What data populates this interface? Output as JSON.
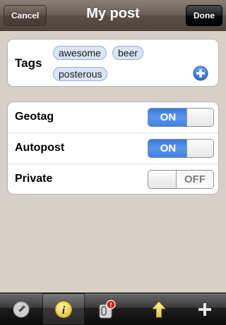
{
  "navbar": {
    "title": "My post",
    "cancel_label": "Cancel",
    "done_label": "Done"
  },
  "tags": {
    "label": "Tags",
    "items": [
      "awesome",
      "beer",
      "posterous"
    ],
    "add_icon": "plus-circle-icon"
  },
  "settings": [
    {
      "label": "Geotag",
      "state": "ON",
      "on": true
    },
    {
      "label": "Autopost",
      "state": "ON",
      "on": true
    },
    {
      "label": "Private",
      "state": "OFF",
      "on": false
    }
  ],
  "tabbar": {
    "items": [
      {
        "icon": "pencil-icon",
        "active": false
      },
      {
        "icon": "info-icon",
        "active": true
      },
      {
        "icon": "attachments-icon",
        "badge": "!",
        "active": false
      },
      {
        "icon": "upload-arrow-icon",
        "active": false
      },
      {
        "icon": "plus-icon",
        "active": false
      }
    ]
  },
  "colors": {
    "navbar": "#6b6058",
    "background": "#d6d0c8",
    "switch_on": "#3e81e6",
    "tag_bg": "#dbe4f3"
  }
}
